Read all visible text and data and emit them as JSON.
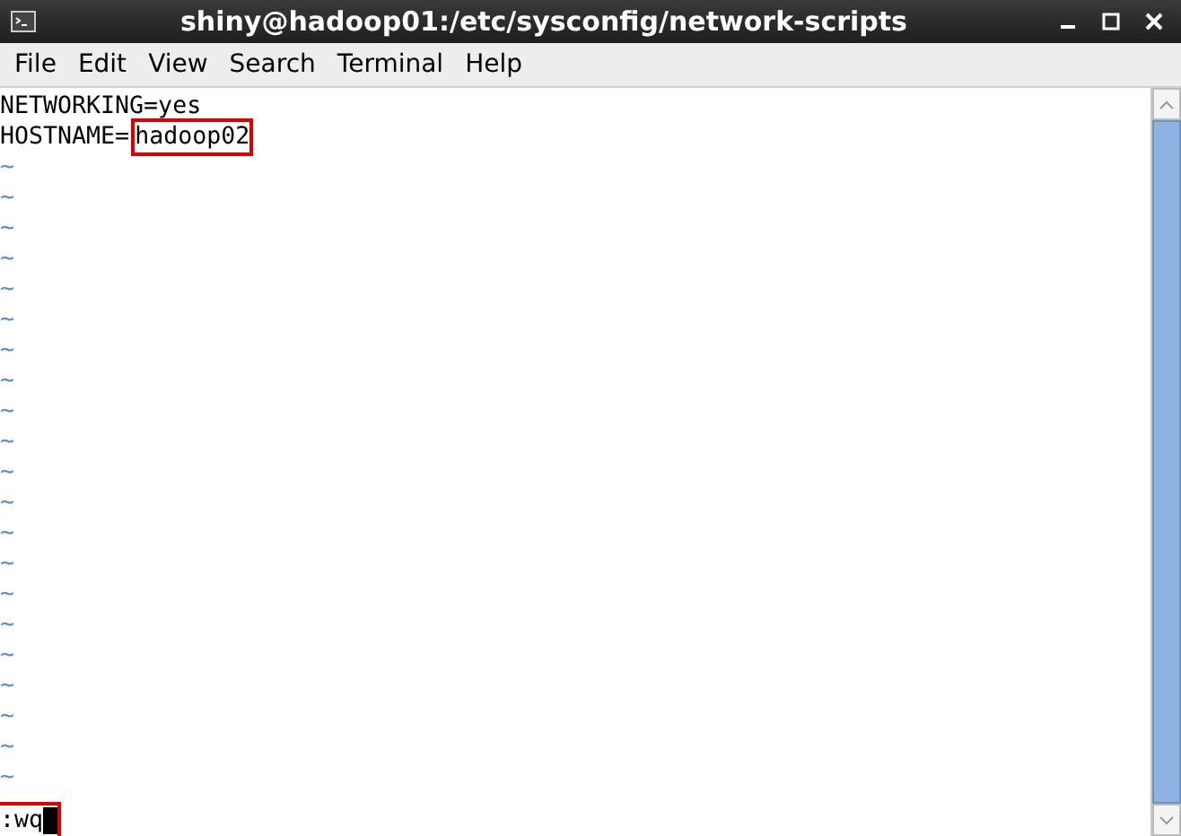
{
  "window": {
    "title": "shiny@hadoop01:/etc/sysconfig/network-scripts"
  },
  "menu": [
    "File",
    "Edit",
    "View",
    "Search",
    "Terminal",
    "Help"
  ],
  "lines": [
    {
      "parts": [
        {
          "text": "NETWORKING=yes",
          "highlighted": false
        }
      ]
    },
    {
      "parts": [
        {
          "text": "HOSTNAME=",
          "highlighted": false
        },
        {
          "text": "hadoop02",
          "highlighted": true
        }
      ]
    }
  ],
  "empty_lines": [
    "~",
    "~",
    "~",
    "~",
    "~",
    "~",
    "~",
    "~",
    "~",
    "~",
    "~",
    "~",
    "~",
    "~",
    "~",
    "~",
    "~",
    "~",
    "~",
    "~",
    "~"
  ],
  "command_line": {
    "text": ":wq",
    "highlighted": true,
    "cursor": true
  }
}
